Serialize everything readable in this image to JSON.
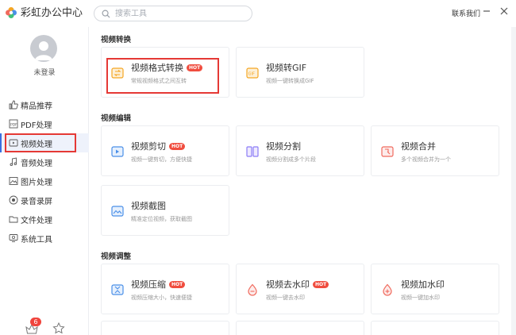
{
  "app": {
    "title": "彩虹办公中心"
  },
  "search": {
    "placeholder": "搜索工具"
  },
  "header": {
    "contact": "联系我们"
  },
  "user": {
    "status": "未登录"
  },
  "sidebar": {
    "items": [
      {
        "label": "精品推荐",
        "icon": "thumbs-up-icon"
      },
      {
        "label": "PDF处理",
        "icon": "pdf-icon"
      },
      {
        "label": "视频处理",
        "icon": "video-icon"
      },
      {
        "label": "音频处理",
        "icon": "music-icon"
      },
      {
        "label": "图片处理",
        "icon": "image-icon"
      },
      {
        "label": "录音录屏",
        "icon": "record-icon"
      },
      {
        "label": "文件处理",
        "icon": "folder-icon"
      },
      {
        "label": "系统工具",
        "icon": "system-icon"
      }
    ],
    "badge_count": "6"
  },
  "sections": [
    {
      "title": "视频转换",
      "cards": [
        {
          "title": "视频格式转换",
          "desc": "常规视频格式之间互转",
          "hot": "HOT"
        },
        {
          "title": "视频转GIF",
          "desc": "视频一键转换成GIF"
        }
      ]
    },
    {
      "title": "视频编辑",
      "cards": [
        {
          "title": "视频剪切",
          "desc": "视频一键剪切，方便快捷",
          "hot": "HOT"
        },
        {
          "title": "视频分割",
          "desc": "视频分割成多个片段"
        },
        {
          "title": "视频合并",
          "desc": "多个视频合并为一个"
        },
        {
          "title": "视频截图",
          "desc": "精准定位视频，获取截图"
        }
      ]
    },
    {
      "title": "视频调整",
      "cards": [
        {
          "title": "视频压缩",
          "desc": "视频压缩大小，快速便捷",
          "hot": "HOT"
        },
        {
          "title": "视频去水印",
          "desc": "视频一键去水印",
          "hot": "HOT"
        },
        {
          "title": "视频加水印",
          "desc": "视频一键加水印"
        }
      ]
    }
  ],
  "colors": {
    "accent": "#3a6fe0",
    "highlight": "#e53935",
    "hot": "#f04d3f",
    "icon_orange": "#f5a623",
    "icon_blue": "#4a8fe8",
    "icon_purple": "#8b7cf6",
    "icon_red": "#f06a5d"
  }
}
